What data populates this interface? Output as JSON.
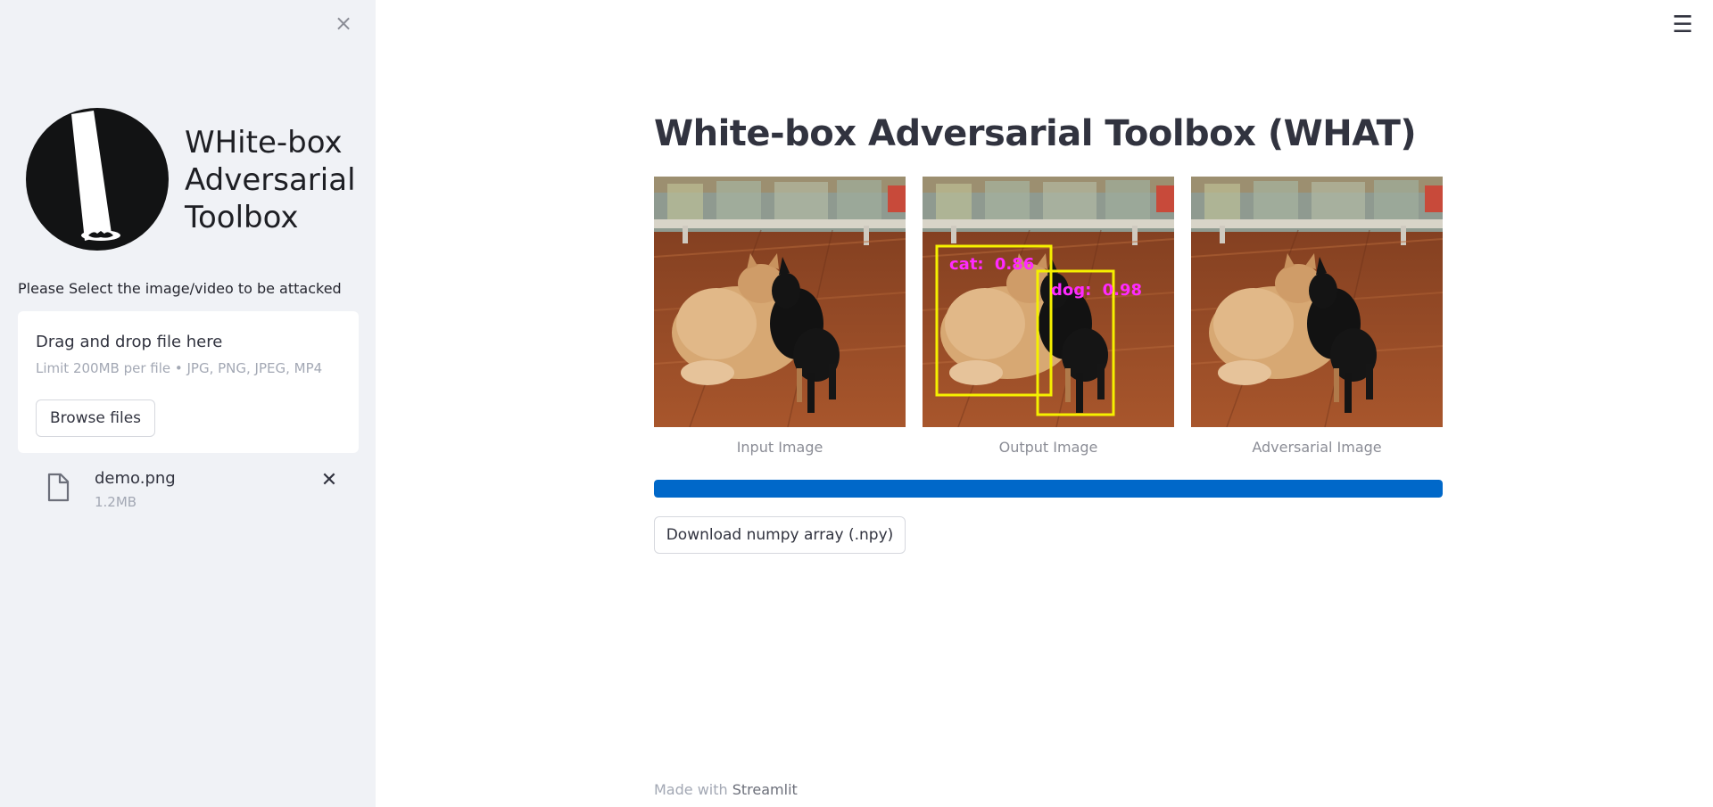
{
  "sidebar": {
    "close_label": "×",
    "brand_lines": [
      "WHite-box",
      "Adversarial",
      "Toolbox"
    ],
    "upload_label": "Please Select the image/video to be attacked",
    "dropzone": {
      "title": "Drag and drop file here",
      "limit": "Limit 200MB per file • JPG, PNG, JPEG, MP4",
      "browse_label": "Browse files"
    },
    "file": {
      "name": "demo.png",
      "size": "1.2MB",
      "remove_label": "✕"
    }
  },
  "header": {
    "menu_label": "☰"
  },
  "main": {
    "title": "White-box Adversarial Toolbox (WHAT)",
    "images": [
      {
        "caption": "Input Image"
      },
      {
        "caption": "Output Image",
        "detections": [
          {
            "label": "cat:",
            "score": "0.86"
          },
          {
            "label": "dog:",
            "score": "0.98"
          }
        ]
      },
      {
        "caption": "Adversarial Image"
      }
    ],
    "progress": 1.0,
    "download_label": "Download numpy array (.npy)"
  },
  "footer": {
    "prefix": "Made with ",
    "link": "Streamlit"
  },
  "colors": {
    "accent": "#0068c9",
    "box": "#f5f000",
    "detection_text": "#ff2aff",
    "sidebar_bg": "#f0f2f6"
  }
}
